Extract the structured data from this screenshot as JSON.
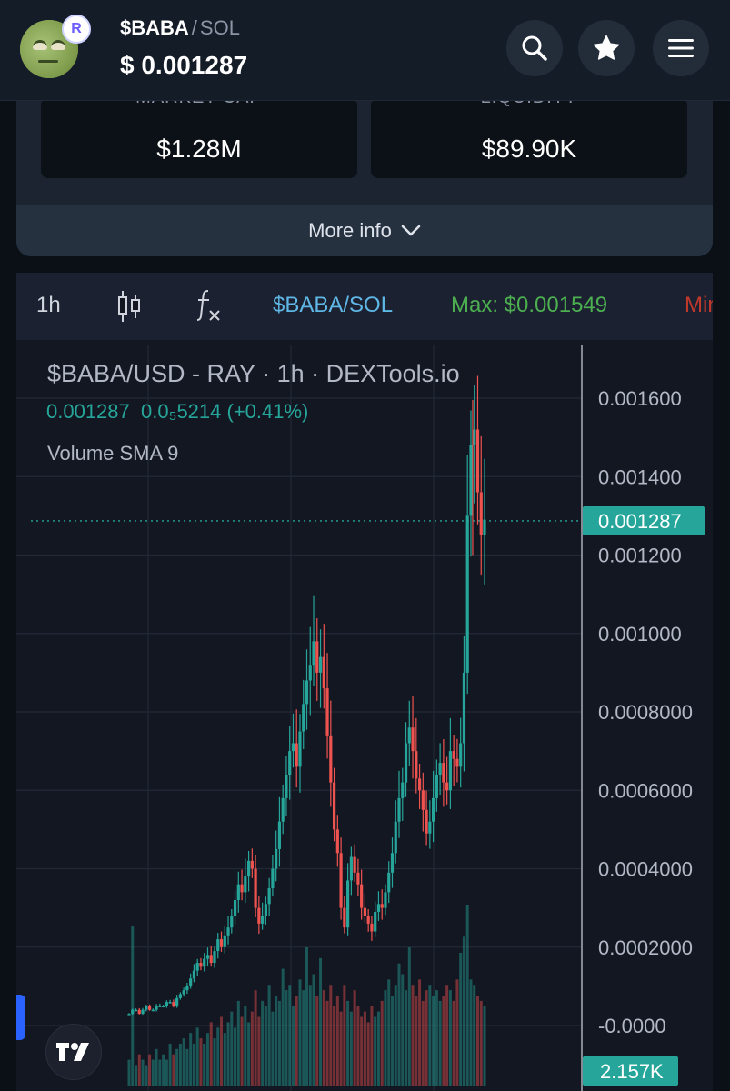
{
  "header": {
    "base_symbol": "$BABA",
    "separator": "/",
    "quote_symbol": "SOL",
    "price": "$ 0.001287",
    "badge_letter": "R"
  },
  "stats": {
    "market_cap_label": "MARKET CAP",
    "market_cap_value": "$1.28M",
    "liquidity_label": "LIQUIDITY",
    "liquidity_value": "$89.90K"
  },
  "more_info": {
    "label": "More info"
  },
  "toolbar": {
    "interval": "1h",
    "pair": "$BABA/SOL",
    "max": "Max: $0.001549",
    "min": "Min"
  },
  "chart_legend": {
    "title": "$BABA/USD - RAY · 1h · DEXTools.io",
    "last": "0.001287",
    "change": "0.0₅5214 (+0.41%)",
    "volume": "Volume SMA 9"
  },
  "colors": {
    "up": "#26a69a",
    "down": "#ef5350",
    "accent": "#2962ff",
    "background": "#131722"
  },
  "chart_data": {
    "type": "candlestick",
    "title": "$BABA/USD - RAY · 1h · DEXTools.io",
    "y_ticks": [
      {
        "value": 0.0016,
        "label": "0.001600"
      },
      {
        "value": 0.0014,
        "label": "0.001400"
      },
      {
        "value": 0.0012,
        "label": "0.001200"
      },
      {
        "value": 0.001,
        "label": "0.001000"
      },
      {
        "value": 0.0008,
        "label": "0.0008000"
      },
      {
        "value": 0.0006,
        "label": "0.0006000"
      },
      {
        "value": 0.0004,
        "label": "0.0004000"
      },
      {
        "value": 0.0002,
        "label": "0.0002000"
      },
      {
        "value": 0.0,
        "label": "-0.0000"
      }
    ],
    "ylim": [
      0,
      0.0016
    ],
    "last_price": 0.001287,
    "last_price_label": "0.001287",
    "volume_label": "2.157K",
    "max_price": 0.001549,
    "close_series": [
      3e-05,
      4e-05,
      4e-05,
      3e-05,
      4e-05,
      5e-05,
      4e-05,
      4e-05,
      5e-05,
      5e-05,
      5e-05,
      6e-05,
      6e-05,
      5e-05,
      7e-05,
      8e-05,
      9e-05,
      0.0001,
      0.00012,
      0.00014,
      0.00016,
      0.00015,
      0.00017,
      0.00018,
      0.00016,
      0.00019,
      0.00022,
      0.0002,
      0.00023,
      0.00025,
      0.00028,
      0.00032,
      0.00036,
      0.00034,
      0.00038,
      0.00042,
      0.0004,
      0.0003,
      0.00026,
      0.00028,
      0.00031,
      0.00035,
      0.0004,
      0.00045,
      0.00052,
      0.00058,
      0.00064,
      0.0007,
      0.00072,
      0.00066,
      0.00075,
      0.00082,
      0.00088,
      0.00092,
      0.00098,
      0.0009,
      0.00094,
      0.00086,
      0.00074,
      0.00062,
      0.0005,
      0.00044,
      0.0003,
      0.00025,
      0.00037,
      0.00043,
      0.00039,
      0.00036,
      0.0003,
      0.00028,
      0.00026,
      0.00024,
      0.00029,
      0.00031,
      0.0003,
      0.00034,
      0.00039,
      0.00044,
      0.00052,
      0.00058,
      0.00062,
      0.00072,
      0.00076,
      0.0007,
      0.00063,
      0.0006,
      0.00055,
      0.00049,
      0.00052,
      0.00058,
      0.00064,
      0.00067,
      0.00062,
      0.0006,
      0.0007,
      0.00068,
      0.00066,
      0.00072,
      0.0009,
      0.0013,
      0.00148,
      0.00152,
      0.00136,
      0.00125,
      0.00129
    ],
    "volume_series": [
      0.5,
      3,
      0.4,
      0.6,
      0.5,
      0.4,
      0.6,
      0.5,
      0.7,
      0.5,
      0.6,
      0.5,
      0.8,
      0.6,
      0.7,
      0.8,
      0.9,
      0.7,
      1.0,
      0.8,
      1.1,
      0.9,
      0.8,
      1.0,
      1.2,
      0.9,
      1.1,
      1.3,
      1.0,
      1.2,
      1.4,
      1.1,
      1.6,
      1.3,
      1.5,
      1.2,
      1.4,
      1.8,
      1.3,
      1.6,
      1.5,
      1.9,
      1.4,
      1.7,
      1.6,
      2.2,
      1.8,
      1.9,
      1.5,
      1.7,
      2.0,
      1.8,
      2.6,
      1.9,
      2.1,
      1.7,
      2.4,
      1.8,
      1.6,
      1.9,
      1.5,
      1.7,
      1.4,
      1.9,
      1.6,
      1.4,
      1.8,
      1.5,
      1.3,
      1.4,
      1.2,
      1.5,
      1.3,
      1.4,
      1.6,
      1.8,
      2.0,
      1.7,
      1.9,
      2.3,
      2.1,
      1.8,
      2.6,
      1.9,
      1.7,
      2.0,
      1.6,
      1.8,
      1.9,
      1.7,
      1.8,
      1.6,
      1.7,
      1.9,
      1.8,
      1.6,
      2.0,
      2.5,
      2.8,
      3.4,
      2.0,
      1.9,
      1.7,
      1.6,
      1.5
    ]
  }
}
